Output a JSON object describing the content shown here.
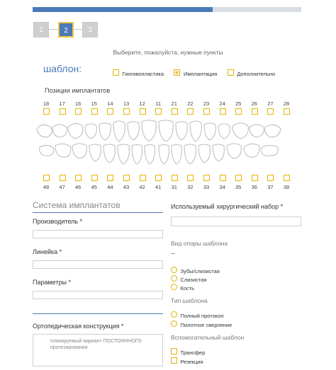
{
  "progress": {
    "fraction": 0.67
  },
  "steps": [
    {
      "label": "1",
      "state": "inactive"
    },
    {
      "label": "2",
      "state": "active"
    },
    {
      "label": "3",
      "state": "inactive"
    }
  ],
  "hint": "Выберите, пожалуйста, нужные пункты",
  "template": {
    "title": "шаблон:",
    "options": [
      {
        "label": "Гингивопластика",
        "checked": false
      },
      {
        "label": "Имплантация",
        "checked": true
      },
      {
        "label": "Дополнительно",
        "checked": false
      }
    ]
  },
  "implant_positions": {
    "title": "Позиции имплантатов",
    "upper": [
      "18",
      "17",
      "16",
      "15",
      "14",
      "13",
      "12",
      "11",
      "21",
      "22",
      "23",
      "24",
      "25",
      "26",
      "27",
      "28"
    ],
    "lower": [
      "48",
      "47",
      "46",
      "45",
      "44",
      "43",
      "42",
      "41",
      "31",
      "32",
      "33",
      "34",
      "35",
      "36",
      "37",
      "38"
    ]
  },
  "implant_system": {
    "title": "Система имплантатов",
    "manufacturer_label": "Производитель *",
    "line_label": "Линейка *",
    "params_label": "Параметры *",
    "ortho_label": "Ортопедическая конструкция *",
    "ortho_placeholder": "планируемый вариант ПОСТОЯННОГО протезирования"
  },
  "surgical_kit": {
    "label": "Используемый хирургический набор *"
  },
  "support_type": {
    "title": "Вид опоры шаблона",
    "value": "--",
    "options": [
      "Зубы/слизистая",
      "Слизистая",
      "Кость"
    ]
  },
  "template_type": {
    "title": "Тип шаблона",
    "options": [
      "Полный протокол",
      "Пилотное сверление"
    ]
  },
  "aux_template": {
    "title": "Вспомогательный шаблон",
    "options": [
      "Трансфер",
      "Резекция"
    ]
  },
  "colors": {
    "accent": "#4a7ab8",
    "checkbox_border": "#e0b100"
  }
}
